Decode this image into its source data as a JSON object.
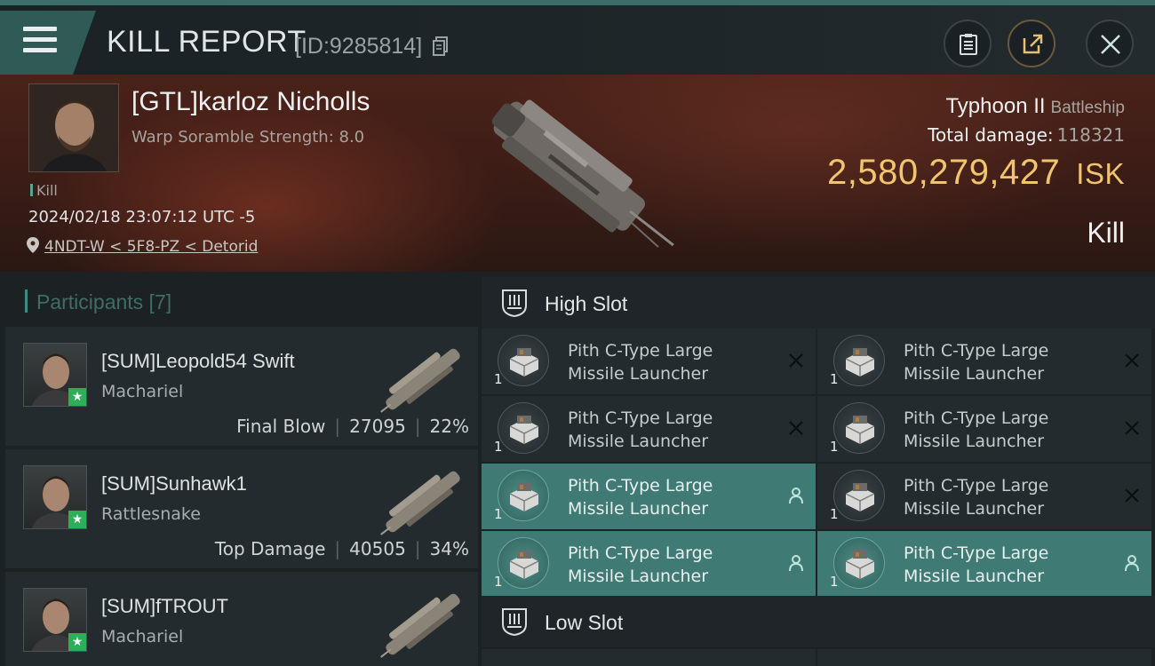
{
  "header": {
    "title": "KILL REPORT",
    "id_text": "[ID:9285814]",
    "menu_icon": "hamburger-menu-icon",
    "copy_icon": "copy-icon",
    "buttons": [
      {
        "icon": "clipboard-icon"
      },
      {
        "icon": "share-icon"
      },
      {
        "icon": "close-icon"
      }
    ]
  },
  "victim": {
    "name": "[GTL]karloz Nicholls",
    "subtitle": "Warp Soramble Strength: 8.0",
    "tag": "Kill",
    "time": "2024/02/18 23:07:12 UTC -5",
    "location": "4NDT-W < 5F8-PZ < Detorid",
    "ship_name": "Typhoon II",
    "ship_class": "Battleship",
    "total_damage_label": "Total damage:",
    "total_damage": "118321",
    "isk_value": "2,580,279,427",
    "isk_unit": "ISK",
    "result": "Kill"
  },
  "participants": {
    "title": "Participants [7]",
    "items": [
      {
        "name": "[SUM]Leopold54 Swift",
        "ship": "Machariel",
        "label": "Final Blow",
        "damage": "27095",
        "percent": "22%"
      },
      {
        "name": "[SUM]Sunhawk1",
        "ship": "Rattlesnake",
        "label": "Top Damage",
        "damage": "40505",
        "percent": "34%"
      },
      {
        "name": "[SUM]fTROUT",
        "ship": "Machariel",
        "label": "",
        "damage": "",
        "percent": ""
      }
    ]
  },
  "slots": {
    "high": {
      "title": "High Slot",
      "modules": [
        {
          "line1": "Pith C-Type Large",
          "line2": "Missile Launcher",
          "qty": "1",
          "status": "destroyed"
        },
        {
          "line1": "Pith C-Type Large",
          "line2": "Missile Launcher",
          "qty": "1",
          "status": "destroyed"
        },
        {
          "line1": "Pith C-Type Large",
          "line2": "Missile Launcher",
          "qty": "1",
          "status": "destroyed"
        },
        {
          "line1": "Pith C-Type Large",
          "line2": "Missile Launcher",
          "qty": "1",
          "status": "destroyed"
        },
        {
          "line1": "Pith C-Type Large",
          "line2": "Missile Launcher",
          "qty": "1",
          "status": "dropped"
        },
        {
          "line1": "Pith C-Type Large",
          "line2": "Missile Launcher",
          "qty": "1",
          "status": "destroyed"
        },
        {
          "line1": "Pith C-Type Large",
          "line2": "Missile Launcher",
          "qty": "1",
          "status": "dropped"
        },
        {
          "line1": "Pith C-Type Large",
          "line2": "Missile Launcher",
          "qty": "1",
          "status": "dropped"
        }
      ]
    },
    "low": {
      "title": "Low Slot"
    }
  },
  "colors": {
    "accent_teal": "#3f7b74",
    "isk_gold": "#f2c46e",
    "star_green": "#2fae5a"
  }
}
